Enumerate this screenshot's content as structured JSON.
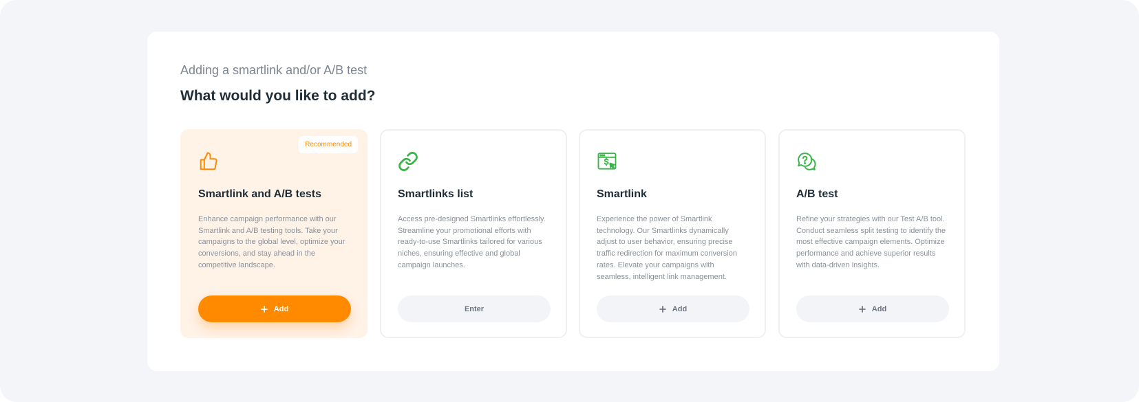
{
  "page": {
    "subtitle": "Adding a smartlink and/or A/B test",
    "heading": "What would you like to add?"
  },
  "colors": {
    "accent": "#ff8a00",
    "icon_green": "#3bb54a",
    "recommended_bg": "#fff2e7",
    "background": "#f4f5f9"
  },
  "cards": [
    {
      "icon": "thumbs-up-icon",
      "title": "Smartlink and A/B tests",
      "badge": "Recommended",
      "description": "Enhance campaign performance with our Smartlink and A/B testing tools. Take your campaigns to the global level, optimize your conversions, and stay ahead in the competitive landscape.",
      "button": {
        "label": "Add",
        "icon": "plus-icon"
      }
    },
    {
      "icon": "link-icon",
      "title": "Smartlinks list",
      "description": "Access pre-designed Smartlinks effortlessly. Streamline your promotional efforts with ready-to-use Smartlinks tailored for various niches, ensuring effective and global campaign launches.",
      "button": {
        "label": "Enter"
      }
    },
    {
      "icon": "browser-dollar-cursor-icon",
      "title": "Smartlink",
      "description": "Experience the power of Smartlink technology. Our Smartlinks dynamically adjust to user behavior, ensuring precise traffic redirection for maximum conversion rates. Elevate your campaigns with seamless, intelligent link management.",
      "button": {
        "label": "Add",
        "icon": "plus-icon"
      }
    },
    {
      "icon": "question-chat-icon",
      "title": "A/B test",
      "description": "Refine your strategies with our Test A/B tool. Conduct seamless split testing to identify the most effective campaign elements. Optimize performance and achieve superior results with data-driven insights.",
      "button": {
        "label": "Add",
        "icon": "plus-icon"
      }
    }
  ]
}
